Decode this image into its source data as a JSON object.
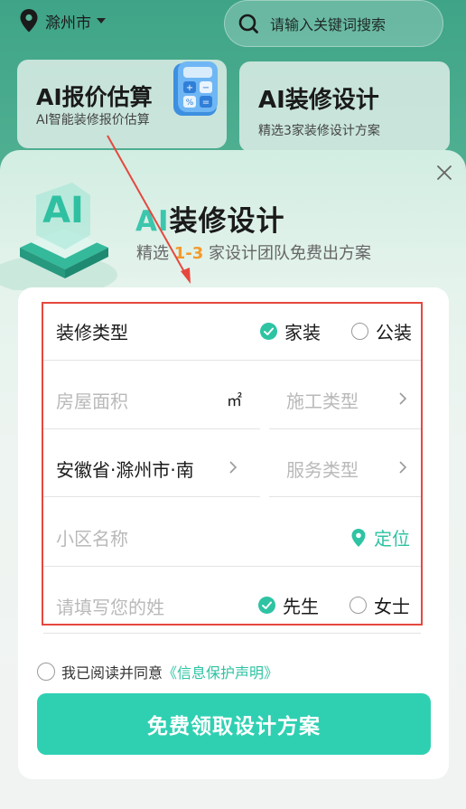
{
  "header": {
    "city": "滁州市",
    "search_placeholder": "请输入关键词搜索"
  },
  "cards": [
    {
      "title": "AI报价估算",
      "subtitle": "AI智能装修报价估算"
    },
    {
      "title": "AI装修设计",
      "subtitle": "精选3家装修设计方案"
    }
  ],
  "modal": {
    "ai_graphic_text": "AI",
    "title_ai": "AI",
    "title_rest": "装修设计",
    "subtitle_pre": "精选 ",
    "subtitle_highlight": "1-3",
    "subtitle_post": " 家设计团队免费出方案",
    "form": {
      "decoration_type_label": "装修类型",
      "option_home": "家装",
      "option_public": "公装",
      "area_placeholder": "房屋面积",
      "area_unit": "㎡",
      "construction_type_placeholder": "施工类型",
      "address_value": "安徽省·滁州市·南",
      "service_type_placeholder": "服务类型",
      "community_placeholder": "小区名称",
      "locate_label": "定位",
      "surname_placeholder": "请填写您的姓",
      "option_mr": "先生",
      "option_ms": "女士"
    },
    "agreement_text": "我已阅读并同意",
    "agreement_link": "《信息保护声明》",
    "submit_label": "免费领取设计方案"
  },
  "colors": {
    "accent": "#2fd0b2",
    "highlight": "#f39a2a",
    "annotation": "#e5483e"
  }
}
